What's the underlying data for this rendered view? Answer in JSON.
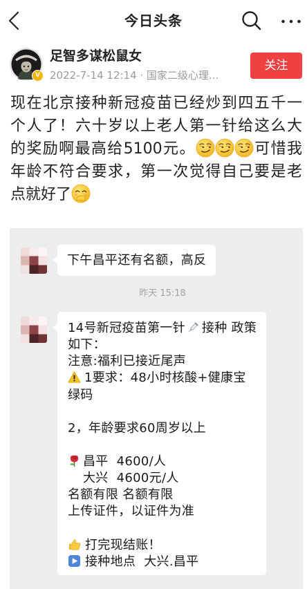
{
  "app": {
    "title": "今日头条",
    "icons": [
      "chevron-left-icon",
      "search-icon",
      "more-dots-icon"
    ]
  },
  "author": {
    "name": "足智多谋松鼠女",
    "badge": "V",
    "meta": "2022-7-14 12:14 · 国家二级心理...",
    "follow_label": "关注"
  },
  "post": {
    "line1": "现在北京接种新冠疫苗已经炒到四五千一",
    "line2": "个人了！六十岁以上老人第一针给这么大",
    "line3_part1": "的奖励啊最高给5100元。",
    "line3_part2": "可惜我",
    "line4": "年龄不符合要求，第一次觉得自己要是老",
    "line5": "点就好了",
    "emoji": [
      "smirk-emoji",
      "smirk-emoji",
      "smirk-emoji",
      "hand-over-mouth-emoji"
    ]
  },
  "chat_screenshot": {
    "message1": "下午昌平还有名额，高反",
    "timestamp": "昨天 15:18",
    "message2": {
      "row1_part1": "14号新冠疫苗第一针",
      "row1_part2": "接种 政策",
      "row2": "如下：",
      "row3": "注意:福利已接近尾声",
      "row4": "1要求：48小时核酸+健康宝",
      "row5": "绿码",
      "row6": "2，年龄要求60周岁以上",
      "row7": "昌平  4600/人",
      "row8": "大兴  4600元/人",
      "row9": "名额有限 名额有限",
      "row10": "上传证件，以证件为准",
      "row11": "打完现结账！",
      "row12": "接种地点  大兴.昌平",
      "icons": [
        "syringe-icon",
        "warning-icon",
        "rose-icon",
        "thumbs-up-icon",
        "play-button-icon"
      ]
    }
  },
  "colors": {
    "text": "#222222",
    "muted": "#9a9a9a",
    "accent": "#f04142",
    "panel": "#ededed",
    "bubble": "#ffffff",
    "timestamp": "#a3a3a3"
  }
}
